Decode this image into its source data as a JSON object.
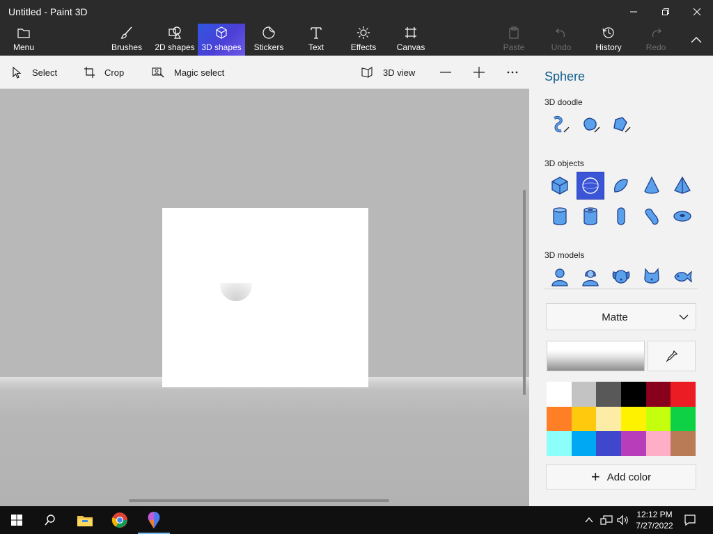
{
  "window": {
    "title": "Untitled - Paint 3D"
  },
  "ribbon": {
    "menu": "Menu",
    "tabs": [
      "Brushes",
      "2D shapes",
      "3D shapes",
      "Stickers",
      "Text",
      "Effects",
      "Canvas"
    ],
    "active_tab": "3D shapes",
    "actions": [
      "Paste",
      "Undo",
      "History",
      "Redo"
    ]
  },
  "toolbar": {
    "select": "Select",
    "crop": "Crop",
    "magic_select": "Magic select",
    "view3d": "3D view"
  },
  "panel": {
    "title": "Sphere",
    "doodle_label": "3D doodle",
    "objects_label": "3D objects",
    "models_label": "3D models",
    "doodle_items": [
      "sharp-doodle-icon",
      "soft-doodle-icon",
      "tube-doodle-icon"
    ],
    "object_items": [
      "cube-icon",
      "sphere-icon",
      "hemisphere-icon",
      "cone-icon",
      "pyramid-icon",
      "cylinder-icon",
      "tube-icon",
      "capsule-icon",
      "curved-cylinder-icon",
      "donut-icon"
    ],
    "selected_object": "sphere-icon",
    "model_items": [
      "man-icon",
      "woman-icon",
      "dog-icon",
      "cat-icon",
      "fish-icon"
    ],
    "material": "Matte",
    "add_color": "Add color",
    "accent_color": "#3a55d6",
    "swatches": [
      "#ffffff",
      "#c3c3c3",
      "#585858",
      "#000000",
      "#88001b",
      "#ec1c24",
      "#ff7f27",
      "#ffc90e",
      "#fdeca6",
      "#fff200",
      "#c4ff0e",
      "#0ed145",
      "#8cfffb",
      "#00a8f3",
      "#3f48cc",
      "#b83dba",
      "#ffaec8",
      "#b97a56"
    ]
  },
  "taskbar": {
    "time": "12:12 PM",
    "date": "7/27/2022"
  }
}
